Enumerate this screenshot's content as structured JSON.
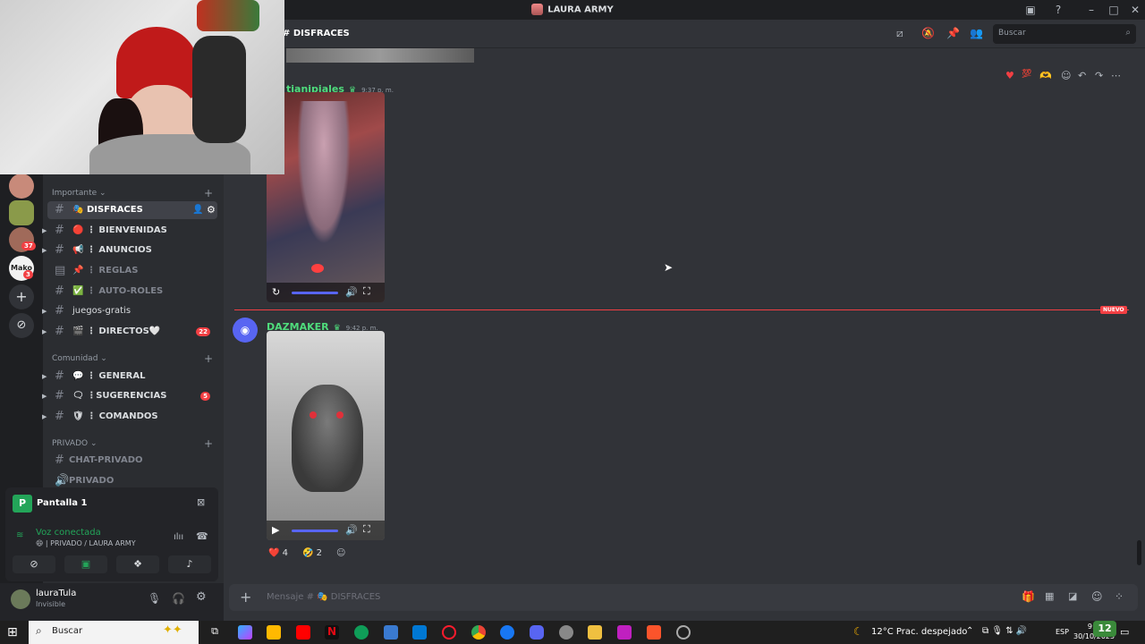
{
  "window": {
    "title": "LAURA ARMY",
    "search_placeholder": "Buscar",
    "channel_title": "DISFRACES"
  },
  "servers": [
    {
      "badge": "37"
    },
    {
      "label": "Mako",
      "badge": "3"
    }
  ],
  "categories": [
    {
      "name": "Importante ⌄"
    },
    {
      "name": "Comunidad ⌄"
    },
    {
      "name": "PRIVADO ⌄"
    }
  ],
  "channels": [
    {
      "emoji": "🎭",
      "name": "DISFRACES"
    },
    {
      "emoji": "🔴",
      "name": "⋮ BIENVENIDAS"
    },
    {
      "emoji": "📢",
      "name": "⋮ ANUNCIOS"
    },
    {
      "emoji": "📌",
      "name": "⋮ REGLAS"
    },
    {
      "emoji": "✅",
      "name": "⋮ AUTO-ROLES"
    },
    {
      "emoji": "",
      "name": "juegos-gratis"
    },
    {
      "emoji": "🎬",
      "name": "⋮ DIRECTOS🤍",
      "badge": "22"
    },
    {
      "emoji": "💬",
      "name": "⋮ GENERAL"
    },
    {
      "emoji": "🗨",
      "name": "⋮SUGERENCIAS",
      "badge": "5"
    },
    {
      "emoji": "🛡",
      "name": "⋮ COMANDOS"
    },
    {
      "emoji": "",
      "name": "CHAT-PRIVADO"
    },
    {
      "emoji": "",
      "name": "PRIVADO"
    }
  ],
  "voice": {
    "stream_name": "Pantalla 1",
    "status": "Voz conectada",
    "location": "😄 | PRIVADO / LAURA ARMY"
  },
  "user": {
    "name": "lauraTula",
    "status": "Invisible"
  },
  "messages": [
    {
      "author": "tianipiales",
      "time": "9:37 p. m."
    },
    {
      "author": "DAZMAKER",
      "time": "9:42 p. m."
    }
  ],
  "divider_label": "NUEVO",
  "reactions": [
    {
      "emoji": "❤️",
      "count": "4"
    },
    {
      "emoji": "🤣",
      "count": "2"
    }
  ],
  "composer": {
    "placeholder": "Mensaje # 🎭 DISFRACES"
  },
  "taskbar": {
    "search": "Buscar",
    "weather": "12°C  Prac. despejado",
    "lang": "ESP",
    "time": "9:46 p. m.",
    "date": "30/10/2025",
    "tray_badge": "12"
  },
  "colors": {
    "accent": "#5865f2",
    "online": "#23a559",
    "danger": "#f23f43",
    "author": "#4fdc7c"
  }
}
